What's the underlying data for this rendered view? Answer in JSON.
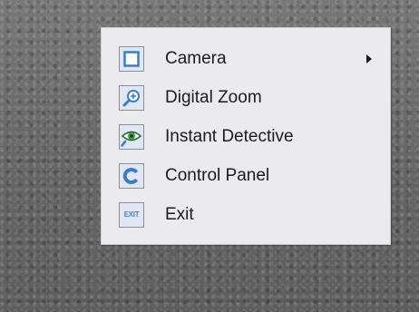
{
  "menu": {
    "items": [
      {
        "label": "Camera",
        "icon": "camera-square-icon",
        "has_submenu": true
      },
      {
        "label": "Digital Zoom",
        "icon": "magnifier-zoom-icon",
        "has_submenu": false
      },
      {
        "label": "Instant Detective",
        "icon": "eye-detective-icon",
        "has_submenu": false
      },
      {
        "label": "Control Panel",
        "icon": "control-panel-c-icon",
        "has_submenu": false
      },
      {
        "label": "Exit",
        "icon": "exit-icon",
        "icon_text": "EXIT",
        "has_submenu": false
      }
    ]
  },
  "colors": {
    "menu_background": "#ebebed",
    "icon_accent": "#3d7cc4",
    "text": "#1b1b1b"
  }
}
